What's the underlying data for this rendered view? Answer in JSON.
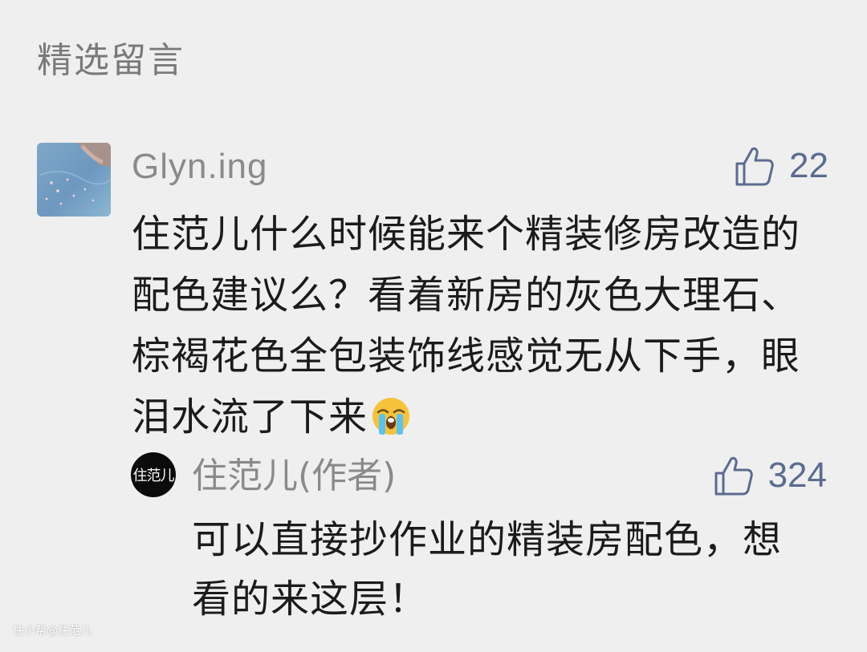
{
  "section": {
    "title": "精选留言"
  },
  "comment": {
    "username": "Glyn.ing",
    "likes": "22",
    "text": "住范儿什么时候能来个精装修房改造的配色建议么？看着新房的灰色大理石、棕褐花色全包装饰线感觉无从下手，眼泪水流了下来",
    "emoji_icon": "loudly-crying-face-icon"
  },
  "reply": {
    "avatar_text": "住范儿",
    "name": "住范儿(作者)",
    "likes": "324",
    "text": "可以直接抄作业的精装房配色，想看的来这层！"
  },
  "watermark": "住小帮@住范儿",
  "colors": {
    "background": "#efefef",
    "like_accent": "#5b6b91",
    "muted_text": "#8a8a8a"
  }
}
